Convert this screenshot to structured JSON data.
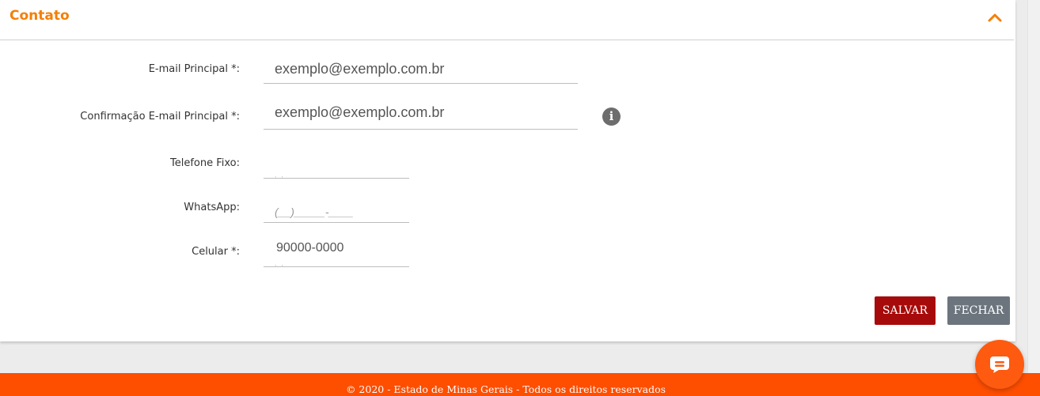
{
  "section": {
    "title": "Contato",
    "collapse_icon": "chevron-up-icon",
    "accent_color": "#f47f05"
  },
  "form": {
    "email": {
      "label": "E-mail Principal *:",
      "value": "exemplo@exemplo.com.br"
    },
    "email_confirm": {
      "label": "Confirmação E-mail Principal *:",
      "value": "exemplo@exemplo.com.br",
      "info_icon": "info-icon"
    },
    "phone": {
      "label": "Telefone Fixo:",
      "value": ""
    },
    "whatsapp": {
      "label": "WhatsApp:",
      "placeholder": "(__)_____-____"
    },
    "mobile": {
      "label": "Celular *:",
      "value": "90000-0000"
    }
  },
  "actions": {
    "save_label": "SALVAR",
    "save_color": "#a70a0a",
    "close_label": "FECHAR",
    "close_color": "#6c757d"
  },
  "footer": {
    "text": "© 2020 - Estado de Minas Gerais - Todos os direitos reservados",
    "color": "#fe4e00"
  },
  "chat": {
    "icon": "chat-bubble-icon"
  }
}
